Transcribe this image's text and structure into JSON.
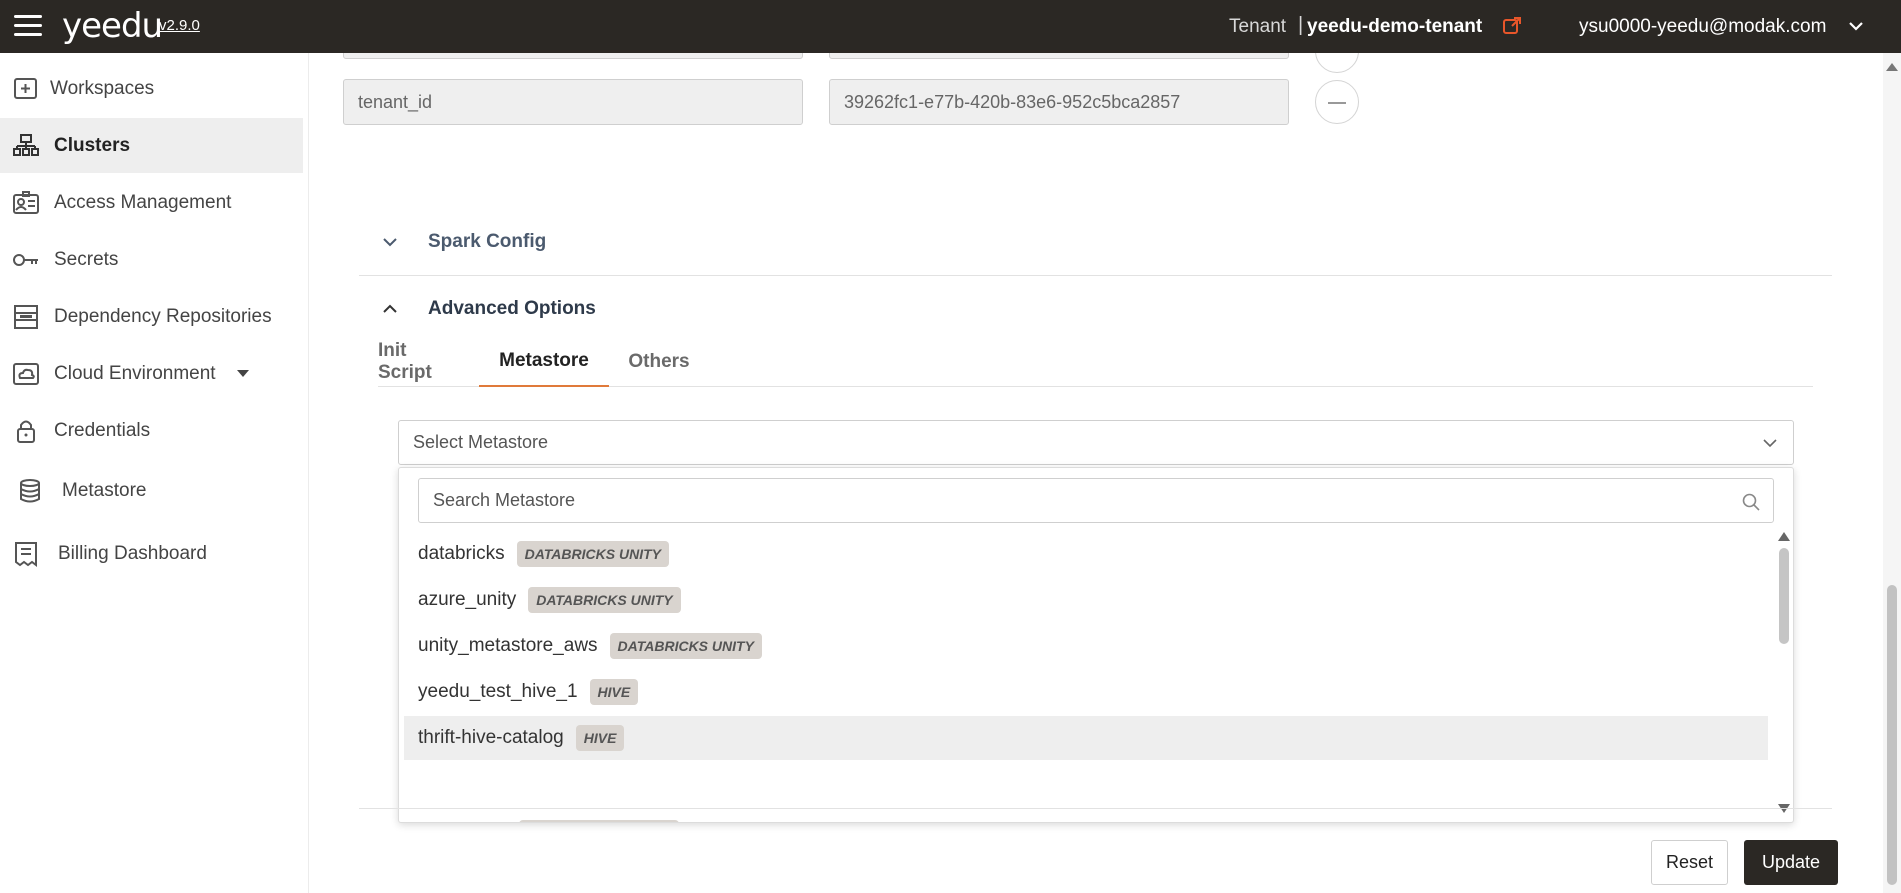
{
  "header": {
    "logo": "yeedu",
    "version": "v2.9.0",
    "tenant_label": "Tenant",
    "tenant_separator": "|",
    "tenant_name": "yeedu-demo-tenant",
    "user_email": "ysu0000-yeedu@modak.com",
    "accent_color": "#e8562a"
  },
  "sidebar": {
    "items": [
      {
        "label": "Workspaces",
        "icon": "workspace-icon"
      },
      {
        "label": "Clusters",
        "icon": "cluster-icon",
        "active": true
      },
      {
        "label": "Access Management",
        "icon": "access-icon"
      },
      {
        "label": "Secrets",
        "icon": "key-icon"
      },
      {
        "label": "Dependency Repositories",
        "icon": "repository-icon"
      },
      {
        "label": "Cloud Environment",
        "icon": "cloud-icon"
      },
      {
        "label": "Credentials",
        "icon": "lock-icon"
      },
      {
        "label": "Metastore",
        "icon": "database-icon"
      },
      {
        "label": "Billing Dashboard",
        "icon": "receipt-icon"
      }
    ]
  },
  "labels_row": {
    "key": "tenant_id",
    "value": "39262fc1-e77b-420b-83e6-952c5bca2857"
  },
  "sections": {
    "spark_config": "Spark Config",
    "advanced_options": "Advanced Options"
  },
  "tabs": [
    {
      "label": "Init Script"
    },
    {
      "label": "Metastore",
      "active": true
    },
    {
      "label": "Others"
    }
  ],
  "metastore_select": {
    "placeholder": "Select Metastore",
    "search_placeholder": "Search Metastore",
    "options": [
      {
        "name": "databricks",
        "type": "DATABRICKS UNITY"
      },
      {
        "name": "azure_unity",
        "type": "DATABRICKS UNITY"
      },
      {
        "name": "unity_metastore_aws",
        "type": "DATABRICKS UNITY"
      },
      {
        "name": "yeedu_test_hive_1",
        "type": "HIVE"
      },
      {
        "name": "thrift-hive-catalog",
        "type": "HIVE",
        "hovered": true
      }
    ]
  },
  "actions": {
    "reset": "Reset",
    "update": "Update"
  }
}
